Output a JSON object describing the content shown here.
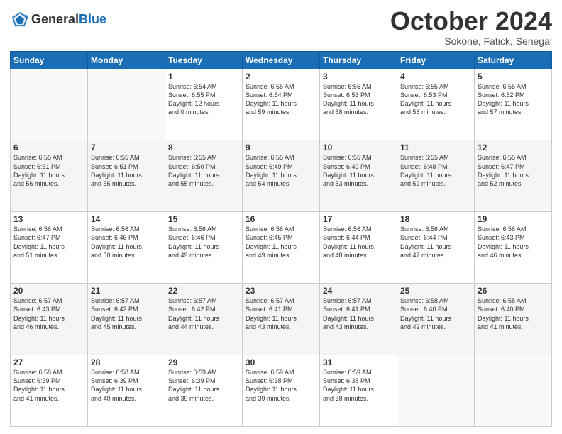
{
  "logo": {
    "line1": "General",
    "line2": "Blue"
  },
  "header": {
    "month": "October 2024",
    "location": "Sokone, Fatick, Senegal"
  },
  "weekdays": [
    "Sunday",
    "Monday",
    "Tuesday",
    "Wednesday",
    "Thursday",
    "Friday",
    "Saturday"
  ],
  "weeks": [
    [
      {
        "day": "",
        "info": ""
      },
      {
        "day": "",
        "info": ""
      },
      {
        "day": "1",
        "info": "Sunrise: 6:54 AM\nSunset: 6:55 PM\nDaylight: 12 hours\nand 0 minutes."
      },
      {
        "day": "2",
        "info": "Sunrise: 6:55 AM\nSunset: 6:54 PM\nDaylight: 11 hours\nand 59 minutes."
      },
      {
        "day": "3",
        "info": "Sunrise: 6:55 AM\nSunset: 6:53 PM\nDaylight: 11 hours\nand 58 minutes."
      },
      {
        "day": "4",
        "info": "Sunrise: 6:55 AM\nSunset: 6:53 PM\nDaylight: 11 hours\nand 58 minutes."
      },
      {
        "day": "5",
        "info": "Sunrise: 6:55 AM\nSunset: 6:52 PM\nDaylight: 11 hours\nand 57 minutes."
      }
    ],
    [
      {
        "day": "6",
        "info": "Sunrise: 6:55 AM\nSunset: 6:51 PM\nDaylight: 11 hours\nand 56 minutes."
      },
      {
        "day": "7",
        "info": "Sunrise: 6:55 AM\nSunset: 6:51 PM\nDaylight: 11 hours\nand 55 minutes."
      },
      {
        "day": "8",
        "info": "Sunrise: 6:55 AM\nSunset: 6:50 PM\nDaylight: 11 hours\nand 55 minutes."
      },
      {
        "day": "9",
        "info": "Sunrise: 6:55 AM\nSunset: 6:49 PM\nDaylight: 11 hours\nand 54 minutes."
      },
      {
        "day": "10",
        "info": "Sunrise: 6:55 AM\nSunset: 6:49 PM\nDaylight: 11 hours\nand 53 minutes."
      },
      {
        "day": "11",
        "info": "Sunrise: 6:55 AM\nSunset: 6:48 PM\nDaylight: 11 hours\nand 52 minutes."
      },
      {
        "day": "12",
        "info": "Sunrise: 6:55 AM\nSunset: 6:47 PM\nDaylight: 11 hours\nand 52 minutes."
      }
    ],
    [
      {
        "day": "13",
        "info": "Sunrise: 6:56 AM\nSunset: 6:47 PM\nDaylight: 11 hours\nand 51 minutes."
      },
      {
        "day": "14",
        "info": "Sunrise: 6:56 AM\nSunset: 6:46 PM\nDaylight: 11 hours\nand 50 minutes."
      },
      {
        "day": "15",
        "info": "Sunrise: 6:56 AM\nSunset: 6:46 PM\nDaylight: 11 hours\nand 49 minutes."
      },
      {
        "day": "16",
        "info": "Sunrise: 6:56 AM\nSunset: 6:45 PM\nDaylight: 11 hours\nand 49 minutes."
      },
      {
        "day": "17",
        "info": "Sunrise: 6:56 AM\nSunset: 6:44 PM\nDaylight: 11 hours\nand 48 minutes."
      },
      {
        "day": "18",
        "info": "Sunrise: 6:56 AM\nSunset: 6:44 PM\nDaylight: 11 hours\nand 47 minutes."
      },
      {
        "day": "19",
        "info": "Sunrise: 6:56 AM\nSunset: 6:43 PM\nDaylight: 11 hours\nand 46 minutes."
      }
    ],
    [
      {
        "day": "20",
        "info": "Sunrise: 6:57 AM\nSunset: 6:43 PM\nDaylight: 11 hours\nand 46 minutes."
      },
      {
        "day": "21",
        "info": "Sunrise: 6:57 AM\nSunset: 6:42 PM\nDaylight: 11 hours\nand 45 minutes."
      },
      {
        "day": "22",
        "info": "Sunrise: 6:57 AM\nSunset: 6:42 PM\nDaylight: 11 hours\nand 44 minutes."
      },
      {
        "day": "23",
        "info": "Sunrise: 6:57 AM\nSunset: 6:41 PM\nDaylight: 11 hours\nand 43 minutes."
      },
      {
        "day": "24",
        "info": "Sunrise: 6:57 AM\nSunset: 6:41 PM\nDaylight: 11 hours\nand 43 minutes."
      },
      {
        "day": "25",
        "info": "Sunrise: 6:58 AM\nSunset: 6:40 PM\nDaylight: 11 hours\nand 42 minutes."
      },
      {
        "day": "26",
        "info": "Sunrise: 6:58 AM\nSunset: 6:40 PM\nDaylight: 11 hours\nand 41 minutes."
      }
    ],
    [
      {
        "day": "27",
        "info": "Sunrise: 6:58 AM\nSunset: 6:39 PM\nDaylight: 11 hours\nand 41 minutes."
      },
      {
        "day": "28",
        "info": "Sunrise: 6:58 AM\nSunset: 6:39 PM\nDaylight: 11 hours\nand 40 minutes."
      },
      {
        "day": "29",
        "info": "Sunrise: 6:59 AM\nSunset: 6:39 PM\nDaylight: 11 hours\nand 39 minutes."
      },
      {
        "day": "30",
        "info": "Sunrise: 6:59 AM\nSunset: 6:38 PM\nDaylight: 11 hours\nand 39 minutes."
      },
      {
        "day": "31",
        "info": "Sunrise: 6:59 AM\nSunset: 6:38 PM\nDaylight: 11 hours\nand 38 minutes."
      },
      {
        "day": "",
        "info": ""
      },
      {
        "day": "",
        "info": ""
      }
    ]
  ]
}
